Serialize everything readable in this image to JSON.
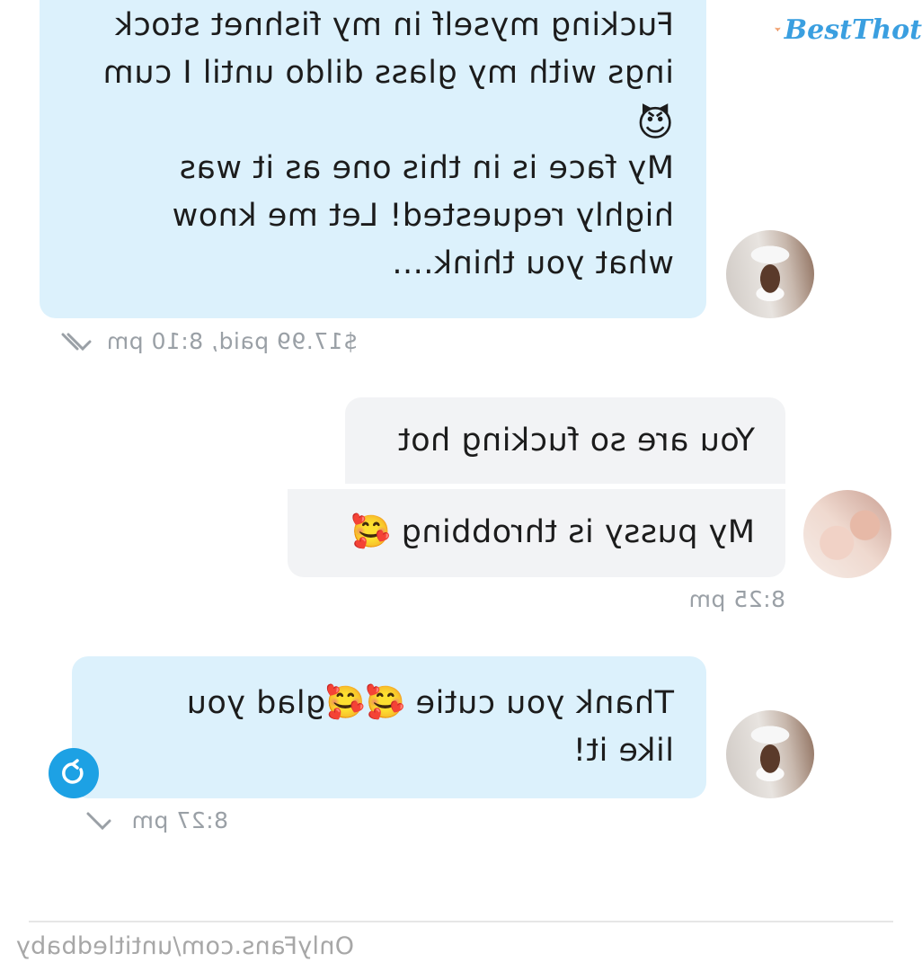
{
  "messages": [
    {
      "lines": [
        "Fucking myself in my fishnet stock",
        "ings with my glass dildo until I cum",
        "😈",
        "My face is in this one as it was",
        "highly requested! Let me know",
        "what you think...."
      ],
      "meta": "$17.99 paid, 8:10 pm"
    },
    {
      "line": "You are so fucking hot"
    },
    {
      "line": "My pussy is throbbing 🥰",
      "meta": "8:25 pm"
    },
    {
      "lines": [
        "Thank you cutie 🥰🥰glad you",
        "like it!"
      ],
      "meta": "8:27 pm"
    }
  ],
  "footer": "OnlyFans.com/untitledbaby",
  "watermark": "BestThot",
  "colors": {
    "incoming_bubble": "#dcf1fc",
    "outgoing_bubble": "#f2f3f5",
    "accent_blue": "#1da1e4",
    "meta_gray": "#9aa0a6"
  },
  "icons": {
    "read_ticks": "double-check-icon",
    "delivered_tick": "check-icon",
    "resend": "refresh-icon"
  }
}
